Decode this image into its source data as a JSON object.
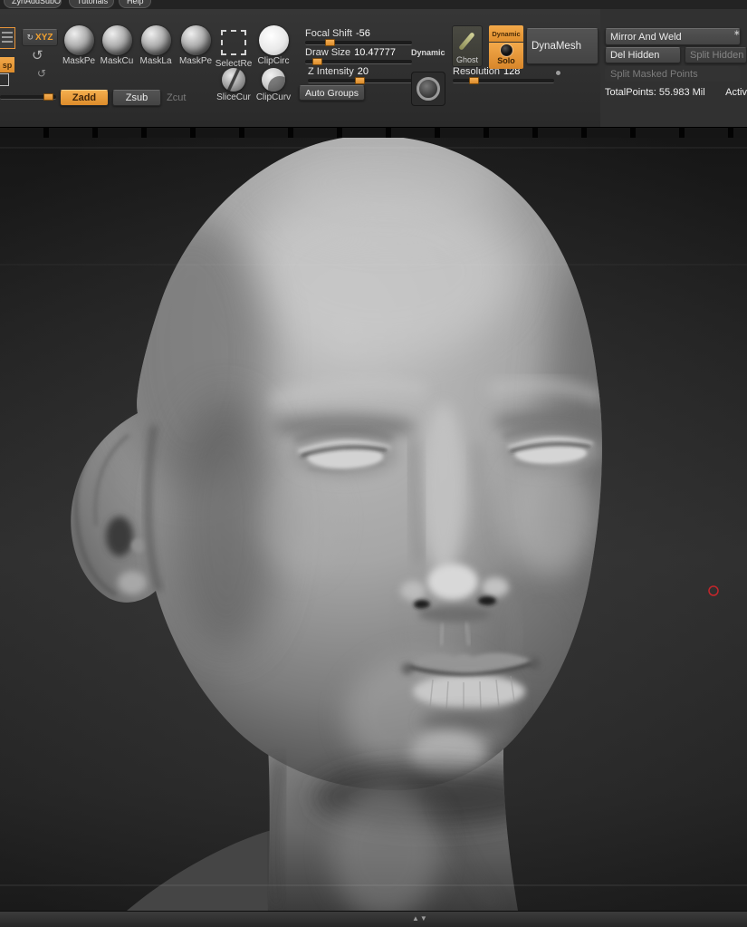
{
  "colors": {
    "accent_orange": "#e8953a",
    "cursor_red": "#c3262b",
    "toolbar_bg": "#2d2d2d"
  },
  "menubar": {
    "items": [
      "ZynAddSubO",
      "Tutorials",
      "Help"
    ]
  },
  "left_tools": {
    "xyz_label": "XYZ",
    "persp_label": "sp"
  },
  "brush_shelf": {
    "row1": [
      {
        "label": "MaskPe",
        "icon": "sphere-brush"
      },
      {
        "label": "MaskCu",
        "icon": "sphere-brush"
      },
      {
        "label": "MaskLa",
        "icon": "sphere-brush"
      },
      {
        "label": "MaskPe",
        "icon": "sphere-brush"
      },
      {
        "label": "SelectRe",
        "icon": "dashed-rect"
      },
      {
        "label": "ClipCirc",
        "icon": "white-circle"
      }
    ],
    "row2": [
      {
        "label": "SliceCur",
        "icon": "slice-circle"
      },
      {
        "label": "ClipCurv",
        "icon": "clip-circle"
      }
    ]
  },
  "sliders": {
    "focal_shift": {
      "label": "Focal Shift",
      "value": "-56"
    },
    "draw_size": {
      "label": "Draw Size",
      "value": "10.47777"
    },
    "z_intensity": {
      "label": "Z Intensity",
      "value": "20"
    },
    "resolution": {
      "label": "Resolution",
      "value": "128"
    },
    "dynamic_label": "Dynamic"
  },
  "buttons": {
    "auto_groups": "Auto Groups",
    "ghost": "Ghost",
    "solo": "Solo",
    "dynamic_toggle": "Dynamic",
    "dynamesh": "DynaMesh",
    "zadd": "Zadd",
    "zsub": "Zsub",
    "zcut": "Zcut"
  },
  "geometry_panel": {
    "mirror_and_weld": "Mirror And Weld",
    "del_hidden": "Del Hidden",
    "split_hidden": "Split Hidden",
    "split_masked_points": "Split Masked Points",
    "total_points": "TotalPoints: 55.983 Mil",
    "active_points_partial": "Activ"
  },
  "bottom_bar": {
    "divider_arrows": "▲▼"
  }
}
